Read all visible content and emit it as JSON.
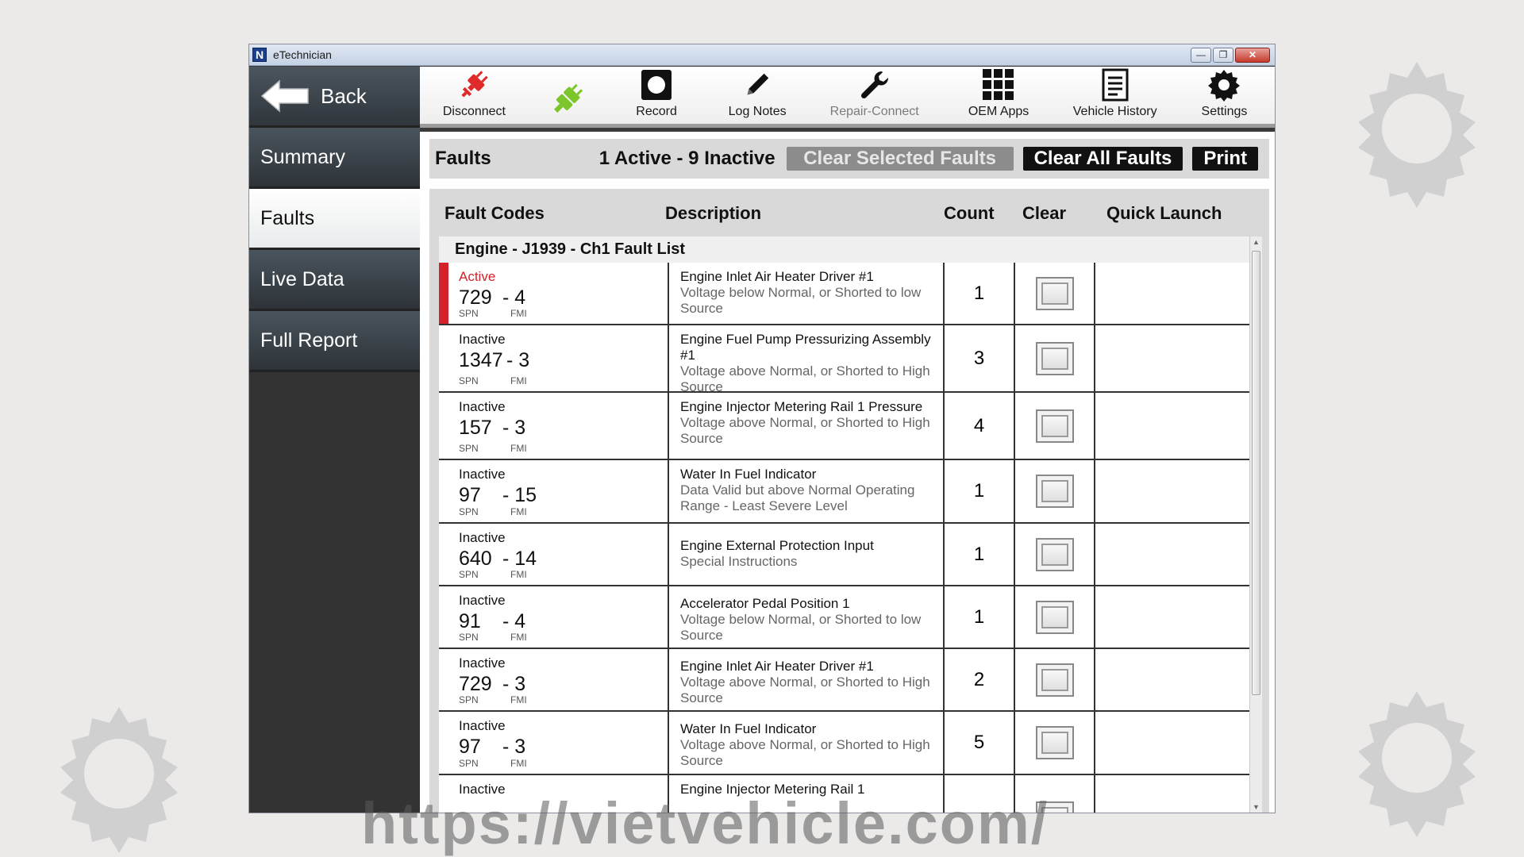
{
  "window": {
    "title": "eTechnician",
    "logo": "N",
    "controls": [
      "minimize-icon",
      "restore-icon",
      "close-icon"
    ]
  },
  "sidebar": {
    "back_label": "Back",
    "items": [
      {
        "label": "Summary",
        "active": false
      },
      {
        "label": "Faults",
        "active": true
      },
      {
        "label": "Live Data",
        "active": false
      },
      {
        "label": "Full Report",
        "active": false
      }
    ]
  },
  "toolbar": {
    "tools": [
      {
        "label": "Disconnect",
        "icon": "disconnect-plug-icon",
        "color": "#e02a2a",
        "enabled": true
      },
      {
        "label": "",
        "icon": "connected-plug-icon",
        "color": "#7cc52a",
        "enabled": true
      },
      {
        "label": "Record",
        "icon": "record-icon",
        "enabled": true
      },
      {
        "label": "Log Notes",
        "icon": "pencil-icon",
        "enabled": true
      },
      {
        "label": "Repair-Connect",
        "icon": "wrench-icon",
        "enabled": false
      },
      {
        "label": "OEM Apps",
        "icon": "grid-icon",
        "enabled": true
      },
      {
        "label": "Vehicle History",
        "icon": "document-icon",
        "enabled": true
      },
      {
        "label": "Settings",
        "icon": "gear-icon",
        "enabled": true
      }
    ]
  },
  "faults": {
    "title": "Faults",
    "summary": "1 Active - 9 Inactive",
    "buttons": {
      "clear_selected": "Clear Selected Faults",
      "clear_all": "Clear All Faults",
      "print": "Print"
    },
    "columns": [
      "Fault Codes",
      "Description",
      "Count",
      "Clear",
      "Quick Launch"
    ],
    "group": "Engine - J1939 - Ch1 Fault List",
    "spn_label": "SPN",
    "fmi_label": "FMI",
    "rows": [
      {
        "status": "Active",
        "spn": "729",
        "fmi": "- 4",
        "desc_main": "Engine Inlet Air Heater Driver #1",
        "desc_sub": "Voltage below Normal, or Shorted to low Source",
        "count": "1"
      },
      {
        "status": "Inactive",
        "spn": "1347",
        "fmi": "- 3",
        "desc_main": "Engine Fuel Pump Pressurizing Assembly #1",
        "desc_sub": "Voltage above Normal, or Shorted to High Source",
        "count": "3"
      },
      {
        "status": "Inactive",
        "spn": "157",
        "fmi": "- 3",
        "desc_main": "Engine Injector Metering Rail 1 Pressure",
        "desc_sub": "Voltage above Normal, or Shorted to High Source",
        "count": "4"
      },
      {
        "status": "Inactive",
        "spn": "97",
        "fmi": "- 15",
        "desc_main": "Water In Fuel Indicator",
        "desc_sub": "Data Valid but above Normal Operating Range - Least Severe Level",
        "count": "1"
      },
      {
        "status": "Inactive",
        "spn": "640",
        "fmi": "- 14",
        "desc_main": "Engine External Protection Input",
        "desc_sub": "Special Instructions",
        "count": "1"
      },
      {
        "status": "Inactive",
        "spn": "91",
        "fmi": "- 4",
        "desc_main": "Accelerator Pedal Position 1",
        "desc_sub": "Voltage below Normal, or Shorted to low Source",
        "count": "1"
      },
      {
        "status": "Inactive",
        "spn": "729",
        "fmi": "- 3",
        "desc_main": "Engine Inlet Air Heater Driver #1",
        "desc_sub": "Voltage above Normal, or Shorted to High Source",
        "count": "2"
      },
      {
        "status": "Inactive",
        "spn": "97",
        "fmi": "- 3",
        "desc_main": "Water In Fuel Indicator",
        "desc_sub": "Voltage above Normal, or Shorted to High Source",
        "count": "5"
      },
      {
        "status": "Inactive",
        "spn": "",
        "fmi": "",
        "desc_main": "Engine Injector Metering Rail 1",
        "desc_sub": "",
        "count": ""
      }
    ]
  },
  "watermark": {
    "url": "https://vietvehicle.com/"
  }
}
